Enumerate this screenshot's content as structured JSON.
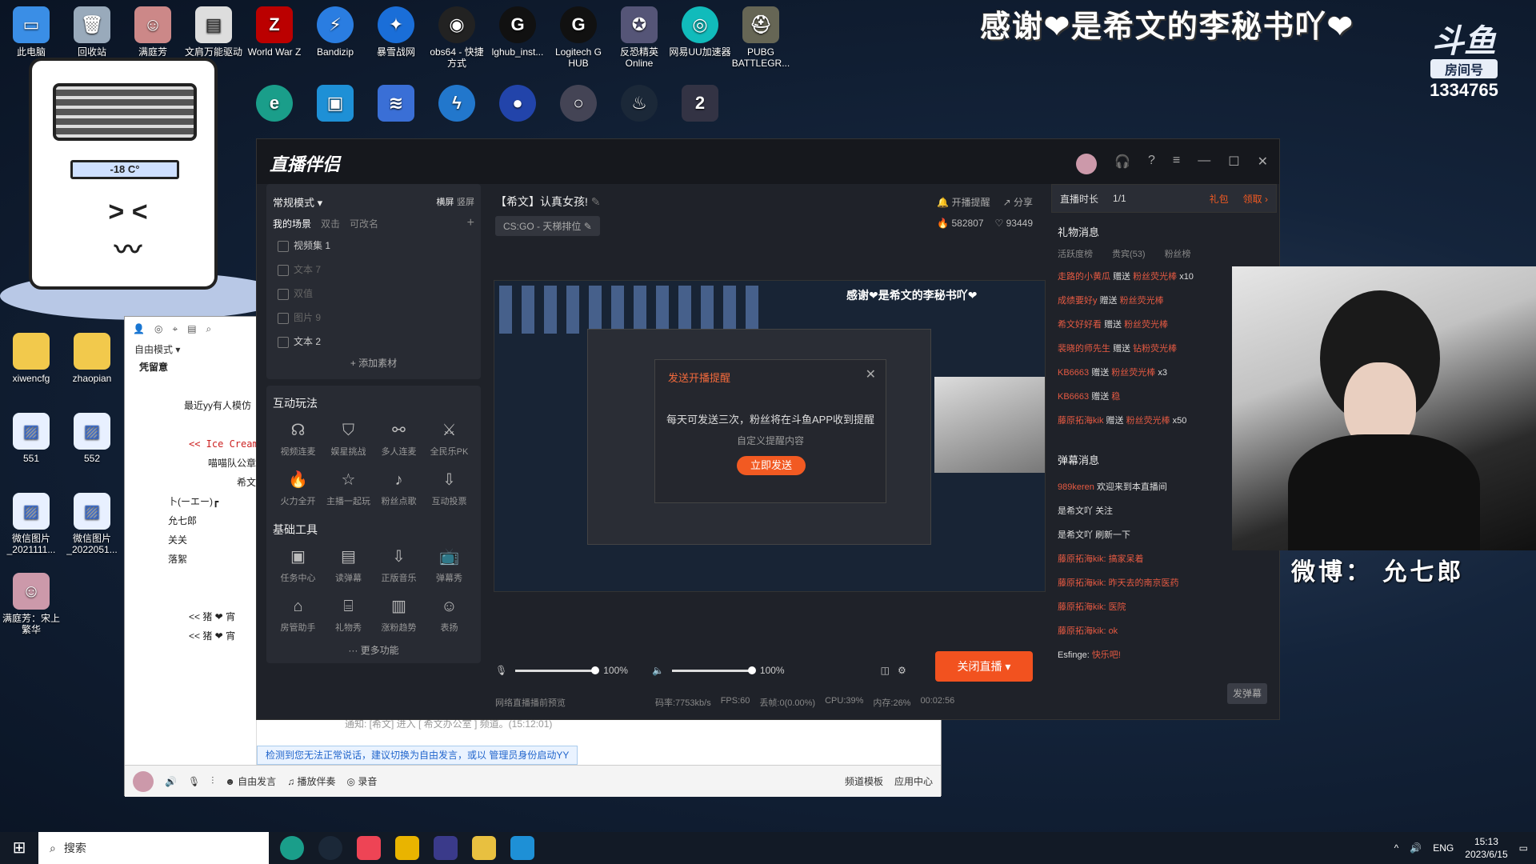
{
  "desktop": {
    "icons": [
      {
        "label": "此电脑"
      },
      {
        "label": "回收站"
      },
      {
        "label": "满庭芳"
      },
      {
        "label": "文肩万能驱动"
      },
      {
        "label": "World War Z"
      },
      {
        "label": "Bandizip"
      },
      {
        "label": "暴雪战网"
      },
      {
        "label": "obs64 - 快捷方式"
      },
      {
        "label": "lghub_inst..."
      },
      {
        "label": "Logitech G HUB"
      },
      {
        "label": "反恐精英 Online"
      },
      {
        "label": "网易UU加速器"
      },
      {
        "label": "PUBG BATTLEGR..."
      },
      {
        "label": "xiwencfg"
      },
      {
        "label": "zhaopian"
      },
      {
        "label": "551"
      },
      {
        "label": "552"
      },
      {
        "label": "微信图片_2021111..."
      },
      {
        "label": "微信图片_2022051..."
      },
      {
        "label": "满庭芳：宋上繁华"
      }
    ],
    "overlay_thanks": "感谢❤是希文的李秘书吖❤",
    "douyu_logo": "斗鱼",
    "room_label": "房间号",
    "room_number": "1334765",
    "ac_temp": "-18 C°",
    "weibo": "微博： 允七郎"
  },
  "yy": {
    "mode": "自由模式",
    "rows": [
      "凭留意",
      "最近yy有人模仿",
      "<< Ice Cream",
      "喵喵队公章",
      "希文",
      "卜(ーエー)┏",
      "允七郎",
      "关关",
      "落絮",
      "<< 猪 ❤ 宵",
      "<< 猪 ❤ 宵"
    ],
    "notice": "检测到您无法正常说话，建议切换为自由发言，或以 管理员身份启动YY",
    "sysmsg": "通知: [希文] 进入 [ 希文办公室 ] 频道。(15:12:01)",
    "bottom": {
      "free_speech": "自由发言",
      "play_music": "播放伴奏",
      "record": "录音",
      "channel_template": "频道模板",
      "app_center": "应用中心"
    }
  },
  "live": {
    "app_title": "直播伴侣",
    "left": {
      "mode": "常规模式",
      "landscape": "横屏",
      "portrait": "竖屏",
      "scene_tabs": [
        "我的场景",
        "双击",
        "可改名"
      ],
      "sources": [
        "视频集 1",
        "文本 7",
        "双值",
        "图片 9",
        "文本 2"
      ],
      "add_source": "添加素材",
      "interactive_title": "互动玩法",
      "interactive": [
        "视频连麦",
        "娱星挑战",
        "多人连麦",
        "全民乐PK",
        "火力全开",
        "主播一起玩",
        "粉丝点歌",
        "互动投票"
      ],
      "basic_title": "基础工具",
      "basic": [
        "任务中心",
        "读弹幕",
        "正版音乐",
        "弹幕秀",
        "房管助手",
        "礼物秀",
        "涨粉趋势",
        "表扬"
      ],
      "more": "更多功能"
    },
    "center": {
      "stream_title": "【希文】认真女孩!",
      "game_tag": "CS:GO - 天梯排位",
      "go_live_remind": "开播提醒",
      "share": "分享",
      "hot": "582807",
      "fans": "93449",
      "dialog": {
        "title": "发送开播提醒",
        "message": "每天可发送三次，粉丝将在斗鱼APP收到提醒",
        "custom": "自定义提醒内容",
        "button": "立即发送"
      },
      "mic_volume": "100%",
      "speaker_volume": "100%",
      "end_button": "关闭直播",
      "status": {
        "network": "网络直播播前预览",
        "bitrate": "码率:7753kb/s",
        "fps": "FPS:60",
        "drop": "丢帧:0(0.00%)",
        "cpu": "CPU:39%",
        "mem": "内存:26%",
        "duration": "00:02:56"
      }
    },
    "right": {
      "live_time": "直播时长",
      "ratio": "1/1",
      "gift_bag": "礼包",
      "claim": "领取",
      "gift_title": "礼物消息",
      "gift_tabs": [
        "活跃度榜",
        "贵宾(53)",
        "粉丝榜"
      ],
      "gift_msgs": [
        {
          "user": "走路的小黄瓜",
          "gift": "粉丝荧光棒",
          "count": "x10"
        },
        {
          "user": "成绩要好y",
          "gift": "粉丝荧光棒",
          "count": ""
        },
        {
          "user": "希文好好看",
          "gift": "粉丝荧光棒",
          "count": ""
        },
        {
          "user": "裴晓的师先生",
          "gift": "钻粉荧光棒",
          "count": ""
        },
        {
          "user": "KB6663",
          "gift": "粉丝荧光棒",
          "count": "x3"
        },
        {
          "user": "KB6663",
          "gift": "稳",
          "count": ""
        },
        {
          "user": "藤原拓海kik",
          "gift": "粉丝荧光棒",
          "count": "x50"
        }
      ],
      "gift_verb": "赠送",
      "danmu_title": "弹幕消息",
      "danmu": [
        {
          "user": "989keren",
          "text": "欢迎来到本直播间"
        },
        {
          "user": "是希文吖",
          "text": "关注"
        },
        {
          "user": "是希文吖",
          "text": "刷新一下"
        },
        {
          "user": "藤原拓海kik:",
          "text": "搞家呆着"
        },
        {
          "user": "藤原拓海kik:",
          "text": "昨天去的南京医药"
        },
        {
          "user": "藤原拓海kik:",
          "text": "医院"
        },
        {
          "user": "藤原拓海kik:",
          "text": "ok"
        },
        {
          "user": "Esfinge:",
          "text": "快乐吧!"
        }
      ],
      "send_danmu": "发弹幕"
    }
  },
  "taskbar": {
    "search": "搜索",
    "lang": "ENG",
    "time": "15:13",
    "date": "2023/6/15"
  }
}
